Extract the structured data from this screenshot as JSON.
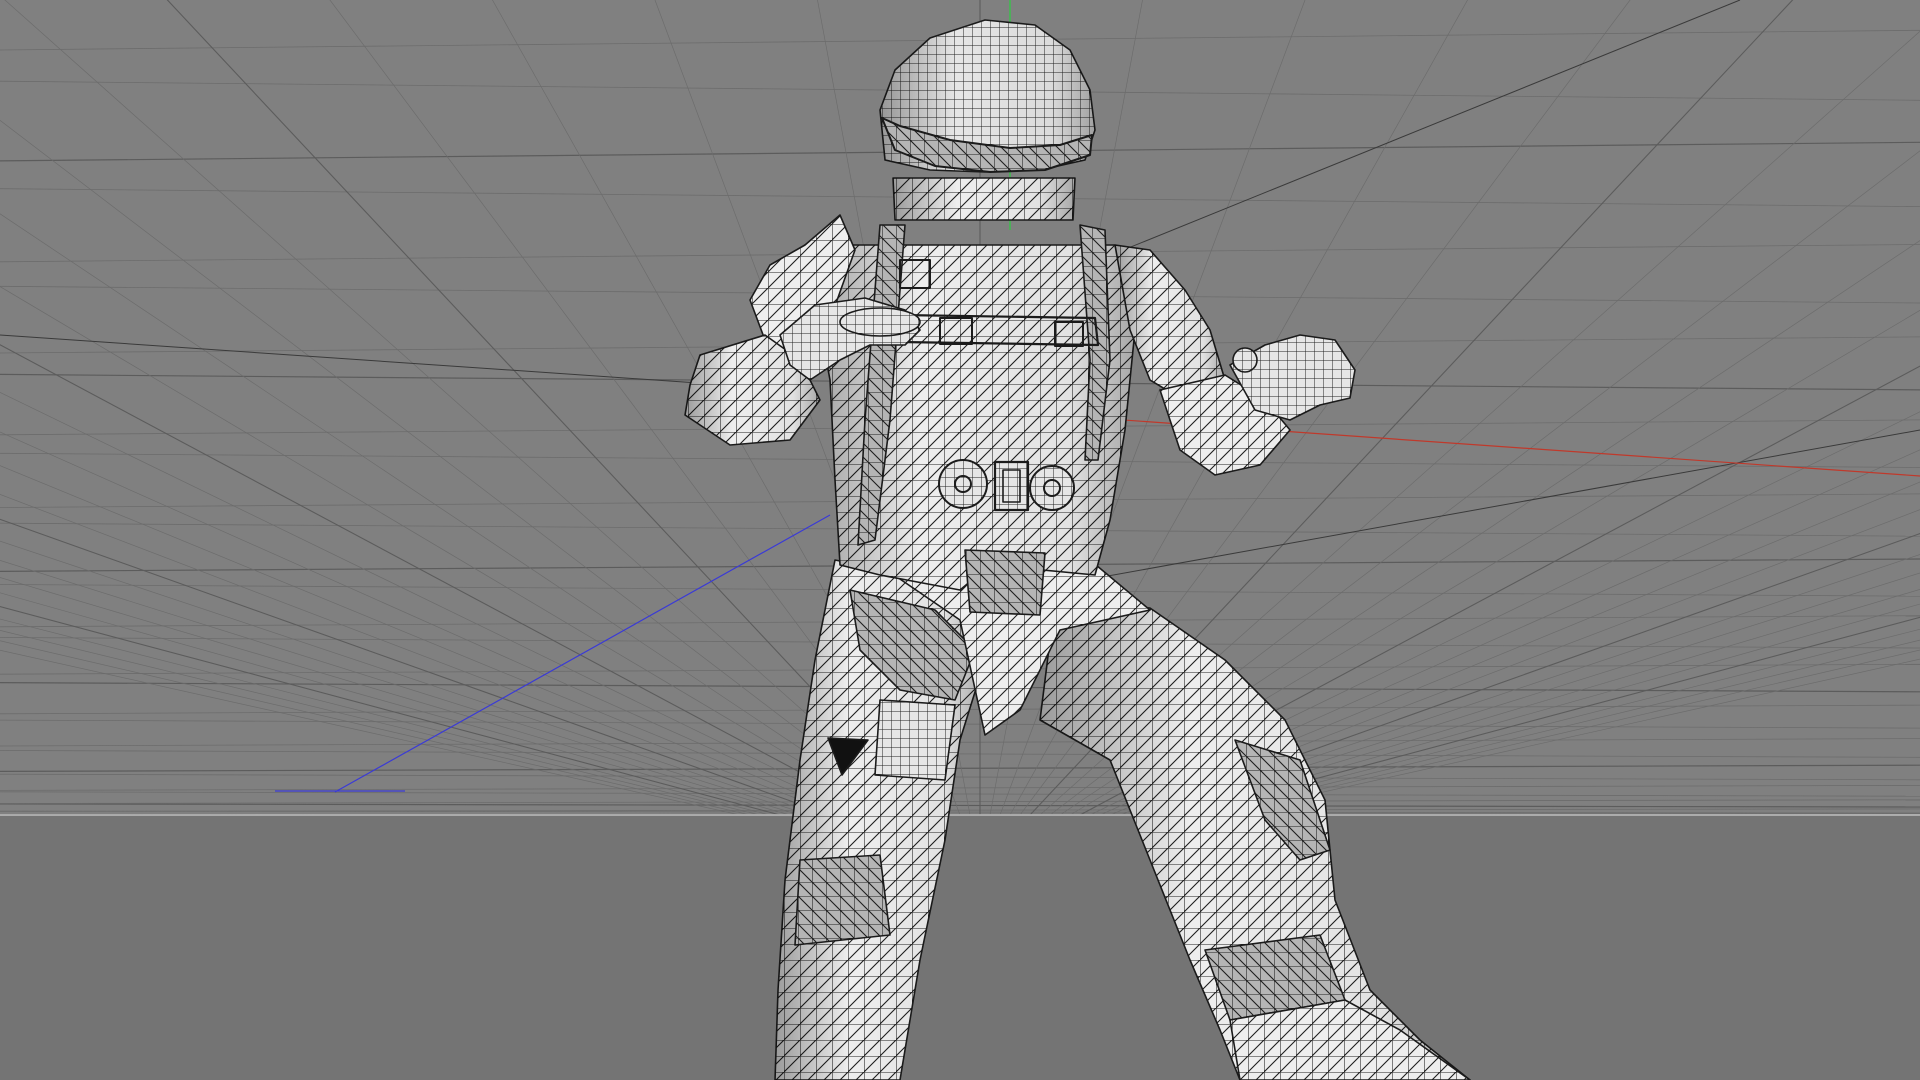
{
  "viewport": {
    "mode": "perspective",
    "display": "shaded-with-lines",
    "object": "astronaut-mesh",
    "colors": {
      "sky": "#808080",
      "floor": "#747474",
      "grid_major": "#5c5c5c",
      "grid_minor": "#6c6c6c",
      "horizon": "#bdbdbd",
      "axis_x": "#c0392b",
      "axis_y": "#2ecc40",
      "axis_z": "#3a3ad6",
      "mesh_fill": "#ededed",
      "mesh_wire": "#1b1b1b"
    }
  }
}
